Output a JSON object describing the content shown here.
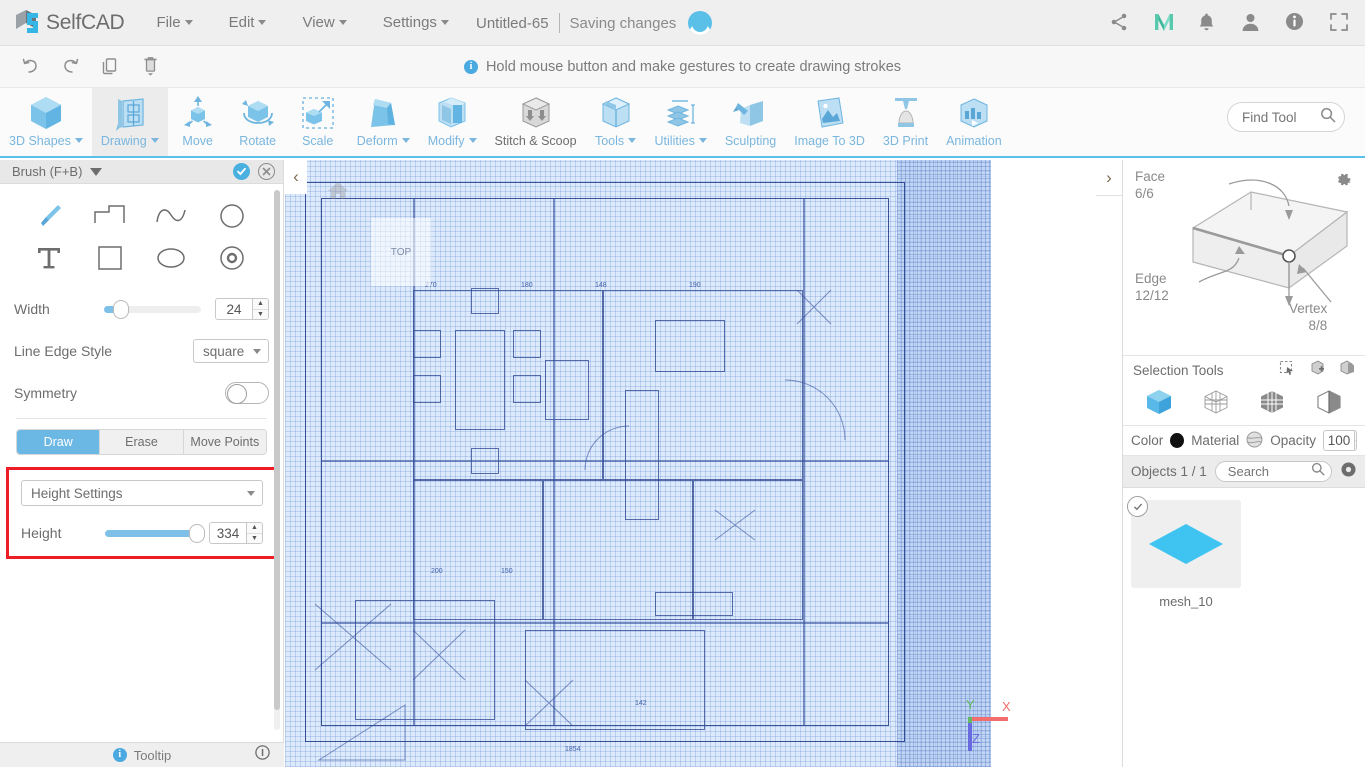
{
  "app": {
    "brand": "SelfCAD",
    "menu": [
      {
        "label": "File",
        "caret": true
      },
      {
        "label": "Edit",
        "caret": true
      },
      {
        "label": "View",
        "caret": true
      },
      {
        "label": "Settings",
        "caret": true
      }
    ],
    "document_title": "Untitled-65",
    "save_status": "Saving changes",
    "topright_icons": [
      "share-icon",
      "medium-m-icon",
      "bell-icon",
      "user-icon",
      "info-icon",
      "fullscreen-icon"
    ]
  },
  "actionbar": {
    "buttons": [
      "undo-icon",
      "redo-icon",
      "copy-icon",
      "delete-icon"
    ],
    "hint": "Hold mouse button and make gestures to create drawing strokes"
  },
  "ribbon": {
    "items": [
      {
        "label": "3D Shapes",
        "caret": true,
        "icon": "cube-icon",
        "active": false,
        "gray": false
      },
      {
        "label": "Drawing",
        "caret": true,
        "icon": "drawing-icon",
        "active": true,
        "gray": false
      },
      {
        "label": "Move",
        "caret": false,
        "icon": "move-icon",
        "active": false,
        "gray": false
      },
      {
        "label": "Rotate",
        "caret": false,
        "icon": "rotate-icon",
        "active": false,
        "gray": false
      },
      {
        "label": "Scale",
        "caret": false,
        "icon": "scale-icon",
        "active": false,
        "gray": false
      },
      {
        "label": "Deform",
        "caret": true,
        "icon": "deform-icon",
        "active": false,
        "gray": false
      },
      {
        "label": "Modify",
        "caret": true,
        "icon": "modify-icon",
        "active": false,
        "gray": false
      },
      {
        "label": "Stitch & Scoop",
        "caret": false,
        "icon": "stitch-scoop-icon",
        "active": false,
        "gray": true
      },
      {
        "label": "Tools",
        "caret": true,
        "icon": "tools-icon",
        "active": false,
        "gray": false
      },
      {
        "label": "Utilities",
        "caret": true,
        "icon": "utilities-icon",
        "active": false,
        "gray": false
      },
      {
        "label": "Sculpting",
        "caret": false,
        "icon": "sculpting-icon",
        "active": false,
        "gray": false
      },
      {
        "label": "Image To 3D",
        "caret": false,
        "icon": "image-to-3d-icon",
        "active": false,
        "gray": false
      },
      {
        "label": "3D Print",
        "caret": false,
        "icon": "3d-print-icon",
        "active": false,
        "gray": false
      },
      {
        "label": "Animation",
        "caret": false,
        "icon": "animation-icon",
        "active": false,
        "gray": false
      }
    ],
    "find_tool_placeholder": "Find Tool",
    "find_tool_value": ""
  },
  "left_panel": {
    "title": "Brush (F+B)",
    "confirm_icon": "check-icon",
    "cancel_icon": "close-icon",
    "shapes": [
      {
        "name": "brush-tool",
        "selected": true
      },
      {
        "name": "step-line-tool",
        "selected": false
      },
      {
        "name": "curve-tool",
        "selected": false
      },
      {
        "name": "circle-outline-tool",
        "selected": false
      },
      {
        "name": "text-tool",
        "selected": false
      },
      {
        "name": "square-tool",
        "selected": false
      },
      {
        "name": "ellipse-tool",
        "selected": false
      },
      {
        "name": "donut-tool",
        "selected": false
      }
    ],
    "width": {
      "label": "Width",
      "value": "24",
      "percent": 10
    },
    "line_edge_style": {
      "label": "Line Edge Style",
      "value": "square"
    },
    "symmetry": {
      "label": "Symmetry",
      "enabled": false
    },
    "modes": [
      {
        "label": "Draw",
        "active": true
      },
      {
        "label": "Erase",
        "active": false
      },
      {
        "label": "Move Points",
        "active": false
      }
    ],
    "height_settings": {
      "dropdown_label": "Height Settings",
      "height_label": "Height",
      "height_value": "334",
      "height_percent": 88,
      "highlight_color": "#ee1c24"
    },
    "footer": {
      "tooltip_label": "Tooltip",
      "info_icon": "info-circle-icon"
    }
  },
  "viewport": {
    "view_label": "TOP",
    "home_icon": "home-icon",
    "collapse_left_icon": "chevron-left-icon",
    "collapse_right_icon": "chevron-right-icon",
    "axes": {
      "x": "X",
      "y": "Y",
      "z": "Z",
      "x_color": "#f26d6d",
      "y_color": "#63b863",
      "z_color": "#6a6ae0"
    },
    "content": "architectural-floor-plan-blueprint"
  },
  "right_panel": {
    "selection": {
      "face_label": "Face",
      "face_count": "6/6",
      "edge_label": "Edge",
      "edge_count": "12/12",
      "vertex_label": "Vertex",
      "vertex_count": "8/8",
      "gear_icon": "gear-icon"
    },
    "selection_tools": {
      "label": "Selection Tools",
      "icons": [
        "rect-select-icon",
        "add-select-icon",
        "subtract-select-icon"
      ]
    },
    "modes": [
      "object-mode-icon",
      "vertex-mode-icon",
      "face-mode-icon",
      "edge-mode-icon"
    ],
    "material_row": {
      "color_label": "Color",
      "color_value": "#111111",
      "material_label": "Material",
      "material_icon": "material-sphere-icon",
      "opacity_label": "Opacity",
      "opacity_value": "100"
    },
    "objects_header": {
      "label": "Objects 1 / 1",
      "search_placeholder": "Search",
      "search_value": "",
      "gear_icon": "gear-icon"
    },
    "objects": [
      {
        "name": "mesh_10",
        "selected": true,
        "thumb_color": "#3fc3f0"
      }
    ]
  }
}
